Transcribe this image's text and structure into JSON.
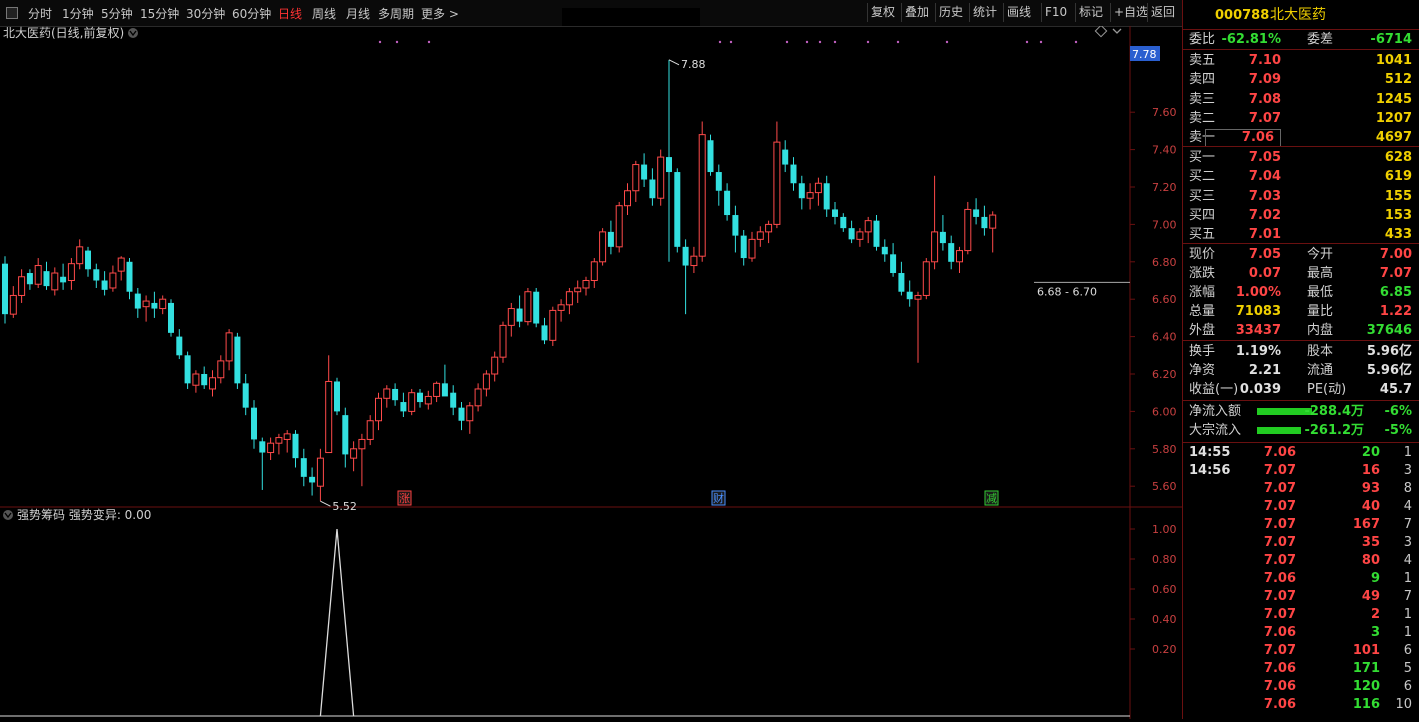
{
  "toolbar": {
    "periods": [
      "分时",
      "1分钟",
      "5分钟",
      "15分钟",
      "30分钟",
      "60分钟",
      "日线",
      "周线",
      "月线",
      "多周期",
      "更多 >"
    ],
    "active_period": "日线",
    "buttons": [
      "复权",
      "叠加",
      "历史",
      "统计",
      "画线",
      "F10",
      "标记",
      "+自选",
      "返回"
    ]
  },
  "chart_title": "北大医药(日线,前复权)",
  "indicator_title": "强势筹码 强势变异: 0.00",
  "price_axis": [
    "7.60",
    "7.40",
    "7.20",
    "7.00",
    "6.80",
    "6.60",
    "6.40",
    "6.20",
    "6.00",
    "5.80",
    "5.60"
  ],
  "current_price_tag": "7.78",
  "indicator_axis": [
    "1.00",
    "0.80",
    "0.60",
    "0.40",
    "0.20"
  ],
  "annotations": {
    "high": "7.88",
    "low": "5.52",
    "range": "6.68 - 6.70"
  },
  "markers": [
    {
      "text": "涨",
      "color": "#ff4040"
    },
    {
      "text": "财",
      "color": "#4a90ff"
    },
    {
      "text": "减",
      "color": "#33cc33"
    }
  ],
  "colors": {
    "up": "#ff4a4a",
    "down": "#33e0e0",
    "panel_border": "#6a1010",
    "accent_yellow": "#f0d000"
  },
  "chart_data": {
    "type": "candlestick",
    "series": [
      {
        "name": "candles",
        "values": [
          [
            6.79,
            6.83,
            6.47,
            6.52
          ],
          [
            6.52,
            6.67,
            6.5,
            6.62
          ],
          [
            6.62,
            6.76,
            6.58,
            6.72
          ],
          [
            6.74,
            6.76,
            6.65,
            6.68
          ],
          [
            6.68,
            6.82,
            6.66,
            6.78
          ],
          [
            6.75,
            6.8,
            6.65,
            6.67
          ],
          [
            6.65,
            6.77,
            6.62,
            6.74
          ],
          [
            6.72,
            6.79,
            6.65,
            6.69
          ],
          [
            6.7,
            6.82,
            6.65,
            6.79
          ],
          [
            6.79,
            6.92,
            6.76,
            6.88
          ],
          [
            6.86,
            6.88,
            6.72,
            6.76
          ],
          [
            6.76,
            6.79,
            6.66,
            6.7
          ],
          [
            6.7,
            6.75,
            6.62,
            6.65
          ],
          [
            6.66,
            6.78,
            6.64,
            6.74
          ],
          [
            6.75,
            6.83,
            6.7,
            6.82
          ],
          [
            6.8,
            6.82,
            6.6,
            6.64
          ],
          [
            6.63,
            6.66,
            6.5,
            6.55
          ],
          [
            6.56,
            6.62,
            6.48,
            6.59
          ],
          [
            6.58,
            6.64,
            6.5,
            6.55
          ],
          [
            6.55,
            6.62,
            6.52,
            6.6
          ],
          [
            6.58,
            6.6,
            6.4,
            6.42
          ],
          [
            6.4,
            6.44,
            6.28,
            6.3
          ],
          [
            6.3,
            6.32,
            6.12,
            6.15
          ],
          [
            6.14,
            6.22,
            6.1,
            6.2
          ],
          [
            6.2,
            6.24,
            6.12,
            6.14
          ],
          [
            6.12,
            6.22,
            6.08,
            6.18
          ],
          [
            6.18,
            6.3,
            6.15,
            6.27
          ],
          [
            6.27,
            6.44,
            6.22,
            6.42
          ],
          [
            6.4,
            6.42,
            6.12,
            6.15
          ],
          [
            6.15,
            6.2,
            5.98,
            6.02
          ],
          [
            6.02,
            6.06,
            5.8,
            5.85
          ],
          [
            5.84,
            5.86,
            5.58,
            5.78
          ],
          [
            5.78,
            5.86,
            5.74,
            5.83
          ],
          [
            5.83,
            5.88,
            5.77,
            5.86
          ],
          [
            5.85,
            5.9,
            5.78,
            5.88
          ],
          [
            5.88,
            5.9,
            5.7,
            5.75
          ],
          [
            5.75,
            5.8,
            5.6,
            5.65
          ],
          [
            5.65,
            5.7,
            5.55,
            5.62
          ],
          [
            5.6,
            5.8,
            5.52,
            5.75
          ],
          [
            5.78,
            6.3,
            5.8,
            6.16
          ],
          [
            6.16,
            6.18,
            5.98,
            6.0
          ],
          [
            5.98,
            6.02,
            5.7,
            5.77
          ],
          [
            5.75,
            5.84,
            5.68,
            5.8
          ],
          [
            5.8,
            5.88,
            5.6,
            5.85
          ],
          [
            5.85,
            5.98,
            5.82,
            5.95
          ],
          [
            5.95,
            6.1,
            5.9,
            6.07
          ],
          [
            6.07,
            6.14,
            6.02,
            6.12
          ],
          [
            6.12,
            6.15,
            6.03,
            6.06
          ],
          [
            6.05,
            6.1,
            5.97,
            6.0
          ],
          [
            6.0,
            6.12,
            5.98,
            6.1
          ],
          [
            6.1,
            6.12,
            6.02,
            6.05
          ],
          [
            6.04,
            6.11,
            6.01,
            6.08
          ],
          [
            6.08,
            6.16,
            6.05,
            6.15
          ],
          [
            6.15,
            6.25,
            6.1,
            6.08
          ],
          [
            6.1,
            6.14,
            5.98,
            6.02
          ],
          [
            6.02,
            6.05,
            5.9,
            5.95
          ],
          [
            5.95,
            6.05,
            5.88,
            6.03
          ],
          [
            6.03,
            6.15,
            6.0,
            6.12
          ],
          [
            6.12,
            6.22,
            6.08,
            6.2
          ],
          [
            6.2,
            6.32,
            6.16,
            6.29
          ],
          [
            6.29,
            6.48,
            6.26,
            6.46
          ],
          [
            6.46,
            6.58,
            6.4,
            6.55
          ],
          [
            6.55,
            6.62,
            6.45,
            6.48
          ],
          [
            6.48,
            6.66,
            6.46,
            6.64
          ],
          [
            6.64,
            6.66,
            6.45,
            6.47
          ],
          [
            6.46,
            6.5,
            6.36,
            6.38
          ],
          [
            6.38,
            6.56,
            6.35,
            6.54
          ],
          [
            6.54,
            6.6,
            6.48,
            6.57
          ],
          [
            6.57,
            6.66,
            6.52,
            6.64
          ],
          [
            6.64,
            6.7,
            6.58,
            6.66
          ],
          [
            6.66,
            6.72,
            6.62,
            6.7
          ],
          [
            6.7,
            6.82,
            6.66,
            6.8
          ],
          [
            6.8,
            6.98,
            6.78,
            6.96
          ],
          [
            6.96,
            7.02,
            6.84,
            6.88
          ],
          [
            6.88,
            7.12,
            6.85,
            7.1
          ],
          [
            7.1,
            7.22,
            7.05,
            7.18
          ],
          [
            7.18,
            7.34,
            7.12,
            7.32
          ],
          [
            7.32,
            7.38,
            7.2,
            7.24
          ],
          [
            7.24,
            7.3,
            7.1,
            7.14
          ],
          [
            7.14,
            7.4,
            7.1,
            7.36
          ],
          [
            7.36,
            7.88,
            6.8,
            7.28
          ],
          [
            7.28,
            7.3,
            6.85,
            6.88
          ],
          [
            6.88,
            6.92,
            6.52,
            6.78
          ],
          [
            6.78,
            6.88,
            6.74,
            6.83
          ],
          [
            6.83,
            7.55,
            6.8,
            7.48
          ],
          [
            7.45,
            7.48,
            7.26,
            7.28
          ],
          [
            7.28,
            7.32,
            7.1,
            7.18
          ],
          [
            7.18,
            7.22,
            7.02,
            7.05
          ],
          [
            7.05,
            7.1,
            6.85,
            6.94
          ],
          [
            6.94,
            6.97,
            6.78,
            6.82
          ],
          [
            6.82,
            6.96,
            6.8,
            6.92
          ],
          [
            6.92,
            6.99,
            6.88,
            6.96
          ],
          [
            6.96,
            7.02,
            6.9,
            7.0
          ],
          [
            7.0,
            7.55,
            6.98,
            7.44
          ],
          [
            7.4,
            7.45,
            7.28,
            7.32
          ],
          [
            7.32,
            7.36,
            7.18,
            7.22
          ],
          [
            7.22,
            7.26,
            7.08,
            7.14
          ],
          [
            7.14,
            7.22,
            7.08,
            7.17
          ],
          [
            7.17,
            7.25,
            7.1,
            7.22
          ],
          [
            7.22,
            7.26,
            7.04,
            7.08
          ],
          [
            7.08,
            7.12,
            7.0,
            7.04
          ],
          [
            7.04,
            7.06,
            6.96,
            6.98
          ],
          [
            6.98,
            7.02,
            6.9,
            6.92
          ],
          [
            6.92,
            6.98,
            6.88,
            6.96
          ],
          [
            6.96,
            7.04,
            6.9,
            7.02
          ],
          [
            7.02,
            7.05,
            6.86,
            6.88
          ],
          [
            6.88,
            6.92,
            6.8,
            6.84
          ],
          [
            6.84,
            6.9,
            6.72,
            6.74
          ],
          [
            6.74,
            6.8,
            6.62,
            6.64
          ],
          [
            6.64,
            6.7,
            6.56,
            6.6
          ],
          [
            6.6,
            6.64,
            6.26,
            6.62
          ],
          [
            6.62,
            6.82,
            6.6,
            6.8
          ],
          [
            6.8,
            7.26,
            6.76,
            6.96
          ],
          [
            6.96,
            7.05,
            6.86,
            6.9
          ],
          [
            6.9,
            6.94,
            6.76,
            6.8
          ],
          [
            6.8,
            6.88,
            6.74,
            6.86
          ],
          [
            6.86,
            7.12,
            6.84,
            7.08
          ],
          [
            7.08,
            7.14,
            7.0,
            7.04
          ],
          [
            7.04,
            7.1,
            6.94,
            6.98
          ],
          [
            6.98,
            7.07,
            6.85,
            7.05
          ]
        ]
      },
      {
        "name": "indicator",
        "values": [
          [
            38,
            0
          ],
          [
            40,
            1.0
          ],
          [
            42,
            0
          ]
        ]
      }
    ],
    "ylim": [
      5.5,
      7.9
    ]
  },
  "sidebar": {
    "code": "000788",
    "name": "北大医药",
    "webi_label": "委比",
    "webi_value": "-62.81%",
    "weicha_label": "委差",
    "weicha_value": "-6714",
    "asks": [
      {
        "label": "卖五",
        "price": "7.10",
        "vol": "1041"
      },
      {
        "label": "卖四",
        "price": "7.09",
        "vol": "512"
      },
      {
        "label": "卖三",
        "price": "7.08",
        "vol": "1245"
      },
      {
        "label": "卖二",
        "price": "7.07",
        "vol": "1207"
      },
      {
        "label": "卖一",
        "price": "7.06",
        "vol": "4697"
      }
    ],
    "bids": [
      {
        "label": "买一",
        "price": "7.05",
        "vol": "628"
      },
      {
        "label": "买二",
        "price": "7.04",
        "vol": "619"
      },
      {
        "label": "买三",
        "price": "7.03",
        "vol": "155"
      },
      {
        "label": "买四",
        "price": "7.02",
        "vol": "153"
      },
      {
        "label": "买五",
        "price": "7.01",
        "vol": "433"
      }
    ],
    "quote": [
      {
        "l1": "现价",
        "v1": "7.05",
        "c1": "red",
        "l2": "今开",
        "v2": "7.00",
        "c2": "red"
      },
      {
        "l1": "涨跌",
        "v1": "0.07",
        "c1": "red",
        "l2": "最高",
        "v2": "7.07",
        "c2": "red"
      },
      {
        "l1": "涨幅",
        "v1": "1.00%",
        "c1": "red",
        "l2": "最低",
        "v2": "6.85",
        "c2": "grn"
      },
      {
        "l1": "总量",
        "v1": "71083",
        "c1": "yel",
        "l2": "量比",
        "v2": "1.22",
        "c2": "red"
      },
      {
        "l1": "外盘",
        "v1": "33437",
        "c1": "red",
        "l2": "内盘",
        "v2": "37646",
        "c2": "grn"
      }
    ],
    "fundamentals": [
      {
        "l1": "换手",
        "v1": "1.19%",
        "l2": "股本",
        "v2": "5.96亿"
      },
      {
        "l1": "净资",
        "v1": "2.21",
        "l2": "流通",
        "v2": "5.96亿"
      },
      {
        "l1": "收益(一)",
        "v1": "0.039",
        "l2": "PE(动)",
        "v2": "45.7"
      }
    ],
    "flows": [
      {
        "label": "净流入额",
        "value": "-288.4万",
        "pct": "-6%",
        "bar": 0.83
      },
      {
        "label": "大宗流入",
        "value": "-261.2万",
        "pct": "-5%",
        "bar": 0.67
      }
    ],
    "ticks": [
      {
        "time": "14:55",
        "price": "7.06",
        "vol": "20",
        "num": "1",
        "dir": "grn"
      },
      {
        "time": "14:56",
        "price": "7.07",
        "vol": "16",
        "num": "3",
        "dir": "red"
      },
      {
        "time": "",
        "price": "7.07",
        "vol": "93",
        "num": "8",
        "dir": "red"
      },
      {
        "time": "",
        "price": "7.07",
        "vol": "40",
        "num": "4",
        "dir": "red"
      },
      {
        "time": "",
        "price": "7.07",
        "vol": "167",
        "num": "7",
        "dir": "red"
      },
      {
        "time": "",
        "price": "7.07",
        "vol": "35",
        "num": "3",
        "dir": "red"
      },
      {
        "time": "",
        "price": "7.07",
        "vol": "80",
        "num": "4",
        "dir": "red"
      },
      {
        "time": "",
        "price": "7.06",
        "vol": "9",
        "num": "1",
        "dir": "grn"
      },
      {
        "time": "",
        "price": "7.07",
        "vol": "49",
        "num": "7",
        "dir": "red"
      },
      {
        "time": "",
        "price": "7.07",
        "vol": "2",
        "num": "1",
        "dir": "red"
      },
      {
        "time": "",
        "price": "7.06",
        "vol": "3",
        "num": "1",
        "dir": "grn"
      },
      {
        "time": "",
        "price": "7.07",
        "vol": "101",
        "num": "6",
        "dir": "red"
      },
      {
        "time": "",
        "price": "7.06",
        "vol": "171",
        "num": "5",
        "dir": "grn"
      },
      {
        "time": "",
        "price": "7.06",
        "vol": "120",
        "num": "6",
        "dir": "grn"
      },
      {
        "time": "",
        "price": "7.06",
        "vol": "116",
        "num": "10",
        "dir": "grn"
      }
    ]
  }
}
